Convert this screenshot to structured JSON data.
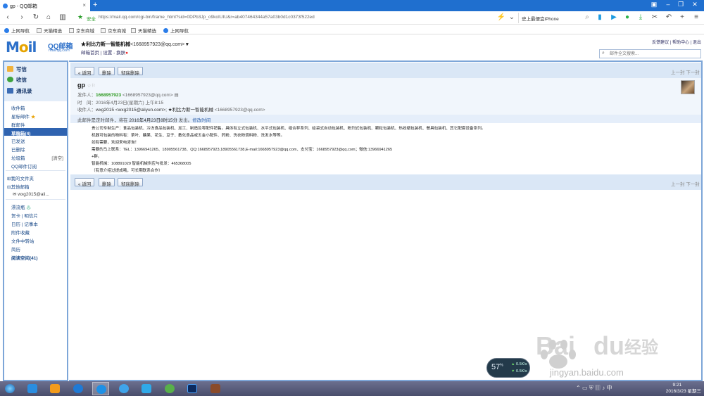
{
  "browser": {
    "tab_title": "gp - QQ邮箱",
    "url_secure_label": "安全",
    "url": "https://mail.qq.com/cgi-bin/frame_html?sid=0DPb3Jp_o9koIUIU&r=ab407464344a57a03b0d1c0373f522ed",
    "search_text": "史上最便宜iPhone",
    "bookmarks": [
      "上网导航",
      "天猫精选",
      "京东商城",
      "京东商城",
      "天猫精选",
      "上网导航"
    ]
  },
  "qqmail": {
    "logo": "Mail",
    "logo_cn": "QQ邮箱",
    "logo_sub": "mail.qq.com",
    "user_name": "★利比力斯一智能机械",
    "user_email": "<1668957923@qq.com>",
    "user_links": [
      "邮箱首页",
      "设置",
      "换肤"
    ],
    "top_links": [
      "反馈建议",
      "帮助中心",
      "退出"
    ],
    "search_placeholder": "邮件全文搜索..."
  },
  "sidebar": {
    "quick": [
      "写信",
      "收信",
      "通讯录"
    ],
    "folders": [
      {
        "label": "收件箱"
      },
      {
        "label": "星标邮件"
      },
      {
        "label": "群邮件"
      },
      {
        "label": "草稿箱(4)"
      },
      {
        "label": "已发送"
      },
      {
        "label": "已删除"
      },
      {
        "label": "垃圾箱",
        "action": "[清空]"
      },
      {
        "label": "QQ邮件订阅"
      }
    ],
    "sections": [
      "我的文件夹",
      "其他邮箱"
    ],
    "other_account": "wxg2015@ali...",
    "apps": [
      {
        "label": "漂流瓶"
      },
      {
        "label": "贺卡",
        "label2": "明信片"
      },
      {
        "label": "日历",
        "label2": "记事本"
      },
      {
        "label": "附件收藏"
      },
      {
        "label": "文件中转站"
      },
      {
        "label": "简历"
      },
      {
        "label": "阅读空间(41)"
      }
    ]
  },
  "mail": {
    "toolbar": {
      "back": "« 返回",
      "delete": "删除",
      "delete_forever": "彻底删除",
      "pager": "上一封   下一封"
    },
    "subject": "gp",
    "sender_label": "发件人：",
    "sender_name": "1668957923",
    "sender_email": "<1668957923@qq.com>",
    "time_label": "时　间：",
    "time": "2016年4月23日(星期六) 上午8:15",
    "to_label": "收件人：",
    "to_1": "wxg2015 <wxg2015@aliyun.com>;",
    "to_2": "★利比力斯一智能机械",
    "to_2_email": "<1668957923@qq.com>",
    "notice_prefix": "此邮件是定时邮件，将在",
    "notice_time": "2016年4月23日8时15分",
    "notice_suffix": "发出。",
    "notice_link": "修改时间",
    "body_lines": [
      "贵公司专制生产：食品包装机、冷冻食品包装机、加工、制造及零配件销售。具体有立式包装机、水平式包装机、组合秤系列、给袋式自动包装机、粉剂式包装机、颗粒包装机、热收缩包装机、餐具包装机、其它配套设备系列。",
      "机器可包装的物料有：茶叶、糖果、花生、豆子、散化食品或五金小配件、药粉、洗衣粉调料粉、洗发水等等。",
      "如有需要，欢迎来电咨询！",
      "需要的马上联系：TEL：13966941265、18905561738、QQ:1668957923,18905561738,E-mail:1668957923@qq.com、支付宝：1668957923@qq.com；微信:13966941265",
      "+群。",
      "智能机械：108891029  智能机械供应与批发：465368005",
      "（有意介绍过提成哦，可长期联系合作）"
    ]
  },
  "widget": {
    "percent": "57",
    "unit": "%",
    "up": "0.5K/s",
    "down": "0.5K/s"
  },
  "taskbar": {
    "time": "9:21",
    "date": "2016/3/23 星期三"
  },
  "watermark": {
    "brand": "Bai",
    "brand2": "du",
    "cn": "经验",
    "url": "jingyan.baidu.com"
  }
}
